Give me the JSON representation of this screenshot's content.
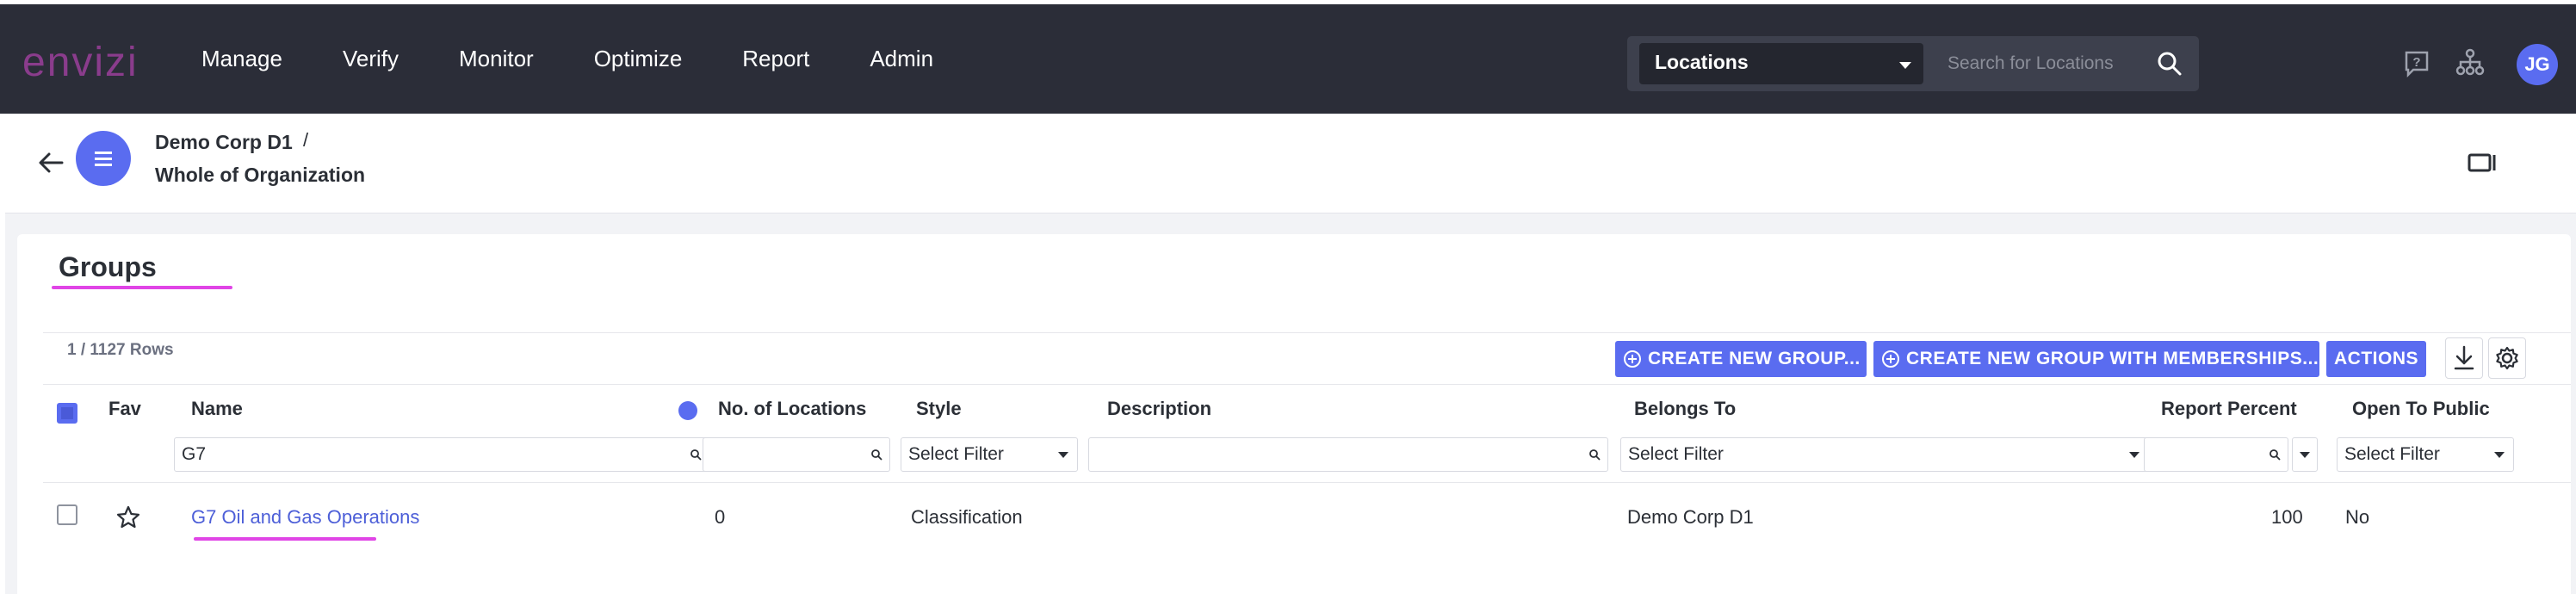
{
  "app": {
    "logo": "envizi"
  },
  "nav": {
    "items": [
      "Manage",
      "Verify",
      "Monitor",
      "Optimize",
      "Report",
      "Admin"
    ]
  },
  "search": {
    "scope": "Locations",
    "placeholder": "Search for Locations"
  },
  "user": {
    "initials": "JG"
  },
  "breadcrumb": {
    "parent": "Demo Corp D1",
    "separator": "/",
    "current": "Whole of Organization"
  },
  "groups": {
    "title": "Groups",
    "rows_count": "1 / 1127 Rows",
    "buttons": {
      "create_group": "CREATE NEW GROUP...",
      "create_with_memberships": "CREATE NEW GROUP WITH MEMBERSHIPS...",
      "actions": "ACTIONS"
    },
    "columns": {
      "fav": "Fav",
      "name": "Name",
      "num_locations": "No. of Locations",
      "style": "Style",
      "description": "Description",
      "belongs_to": "Belongs To",
      "report_percent": "Report Percent",
      "open_to_public": "Open To Public"
    },
    "filters": {
      "name": "G7",
      "num_locations": "",
      "style": "Select Filter",
      "description": "",
      "belongs_to": "Select Filter",
      "report_percent": "",
      "open_to_public": "Select Filter"
    },
    "rows": [
      {
        "name": "G7 Oil and Gas Operations",
        "num_locations": "0",
        "style": "Classification",
        "description": "",
        "belongs_to": "Demo Corp D1",
        "report_percent": "100",
        "open_to_public": "No"
      }
    ]
  },
  "colors": {
    "nav_bg": "#2b2d38",
    "accent": "#5a6cf0",
    "logo": "#8a3c8c",
    "highlight": "#e045e6"
  }
}
